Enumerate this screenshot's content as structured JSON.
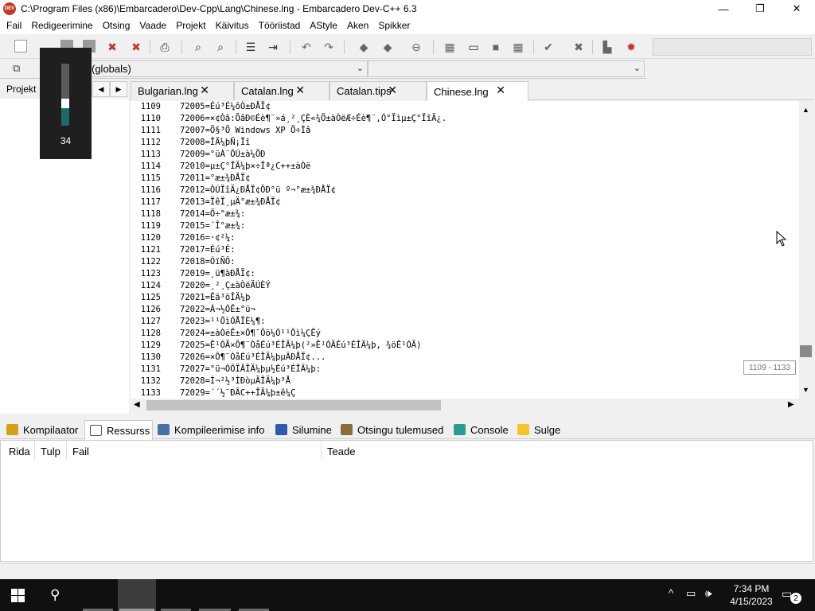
{
  "window": {
    "app_icon_text": "DEV",
    "title": "C:\\Program Files (x86)\\Embarcadero\\Dev-Cpp\\Lang\\Chinese.lng - Embarcadero Dev-C++ 6.3",
    "minimize": "—",
    "maximize": "❐",
    "close": "✕"
  },
  "menu": [
    "Fail",
    "Redigeerimine",
    "Otsing",
    "Vaade",
    "Projekt",
    "Käivitus",
    "Tööriistad",
    "AStyle",
    "Aken",
    "Spikker"
  ],
  "scope": {
    "class_combo": "",
    "function_combo": "(globals)",
    "right_combo": ""
  },
  "left_panel": {
    "tab_label": "Projekt",
    "prev_arrow": "◀",
    "next_arrow": "▶"
  },
  "volume": {
    "level": 34,
    "label": "34"
  },
  "editor_tabs": [
    {
      "label": "Bulgarian.lng",
      "close": "✕"
    },
    {
      "label": "Catalan.lng",
      "close": "✕"
    },
    {
      "label": "Catalan.tips",
      "close": "✕"
    },
    {
      "label": "Chinese.lng",
      "close": "✕"
    }
  ],
  "editor": {
    "lines": [
      {
        "n": "1109",
        "t": "72005=Éú³É¼ôÒ±ÐÅÏ¢"
      },
      {
        "n": "1110",
        "t": "72006=×¢Òâ:ÕâÐ©Éè¶¨»á¸²¸ÇÈ«¾Ö±àÒëÆ÷Éè¶¨,Ó°Ïìµ±Ç°ÏîÄ¿."
      },
      {
        "n": "1111",
        "t": "72007=Õ§³Ö Windows XP Ö÷Ìâ"
      },
      {
        "n": "1112",
        "t": "72008=ÎÄ¼þÑ¡Ïî"
      },
      {
        "n": "1113",
        "t": "72009=°üÀ¨ÔÚ±à¼­ÖÐ"
      },
      {
        "n": "1114",
        "t": "72010=µ±Ç°ÎÄ¼þ×÷Îª¿C++±àÒë"
      },
      {
        "n": "1115",
        "t": "72011=°æ±¾ÐÅÏ¢"
      },
      {
        "n": "1116",
        "t": "72012=ÔÚÏîÄ¿ÐÅÏ¢ÖÐ°ü º¬°æ±¾ÐÅÏ¢"
      },
      {
        "n": "1117",
        "t": "72013=ÏêÏ¸µÄ°æ±¾ÐÅÏ¢"
      },
      {
        "n": "1118",
        "t": "72014=Ö÷°æ±¾:"
      },
      {
        "n": "1119",
        "t": "72015=´Î°æ±¾:"
      },
      {
        "n": "1120",
        "t": "72016=·¢²¼:"
      },
      {
        "n": "1121",
        "t": "72017=Éú³É:"
      },
      {
        "n": "1122",
        "t": "72018=ÓïÑÔ:"
      },
      {
        "n": "1123",
        "t": "72019=¸ü¶àÐÅÏ¢:"
      },
      {
        "n": "1124",
        "t": "72020=¸²¸Ç±àÒëÄÚÈÝ"
      },
      {
        "n": "1125",
        "t": "72021=Êä³öÎÄ¼þ"
      },
      {
        "n": "1126",
        "t": "72022=Á¬½ÓÊ±°ü¬"
      },
      {
        "n": "1127",
        "t": "72023=¹¹ÔìÓÅÏÈ¼¶:"
      },
      {
        "n": "1128",
        "t": "72024=±àÒëÊ±×Ô¶¯Ôö¼Ó¹¹Ôì¼ÇÊý"
      },
      {
        "n": "1129",
        "t": "72025=Ê¹ÓÃ×Ô¶¨ÒåÉú³ÉÎÄ¼þ(²»Ê¹ÓÃÉú³ÉÎÄ¼þ, ¾öÊ¹ÓÃ)"
      },
      {
        "n": "1130",
        "t": "72026=×Ô¶¨ÒåÉú³ÉÎÄ¼þµÄÐÅÏ¢..."
      },
      {
        "n": "1131",
        "t": "72027=°ü¬ÒÔÏÂÎÄ¼þµ½Éú³ÉÎÄ¼þ:"
      },
      {
        "n": "1132",
        "t": "72028=Í¬²½³ÌÐòµÄÎÄ¼þ³Å"
      },
      {
        "n": "1133",
        "t": "72029=´´½¨ÐÂC++ÎÄ¼þ±ê¼Ç"
      }
    ],
    "scroll_tooltip": "1109 - 1133",
    "up_arrow": "▲",
    "down_arrow": "▼",
    "left_arrow": "◀",
    "right_arrow": "▶"
  },
  "bottom_tabs": [
    {
      "label": "Kompilaator",
      "color": "#d4a017"
    },
    {
      "label": "Ressurss",
      "color": "#ffffff"
    },
    {
      "label": "Kompileerimise info",
      "color": "#4a6fa5"
    },
    {
      "label": "Silumine",
      "color": "#2e5aa8"
    },
    {
      "label": "Otsingu tulemused",
      "color": "#8a6d3b"
    },
    {
      "label": "Console",
      "color": "#2a9d8f"
    },
    {
      "label": "Sulge",
      "color": "#f4c430"
    }
  ],
  "results_columns": [
    "Rida",
    "Tulp",
    "Fail",
    "Teade"
  ],
  "taskbar": {
    "time": "7:34 PM",
    "date": "4/15/2023",
    "notification_count": "2",
    "tray_up": "^"
  }
}
